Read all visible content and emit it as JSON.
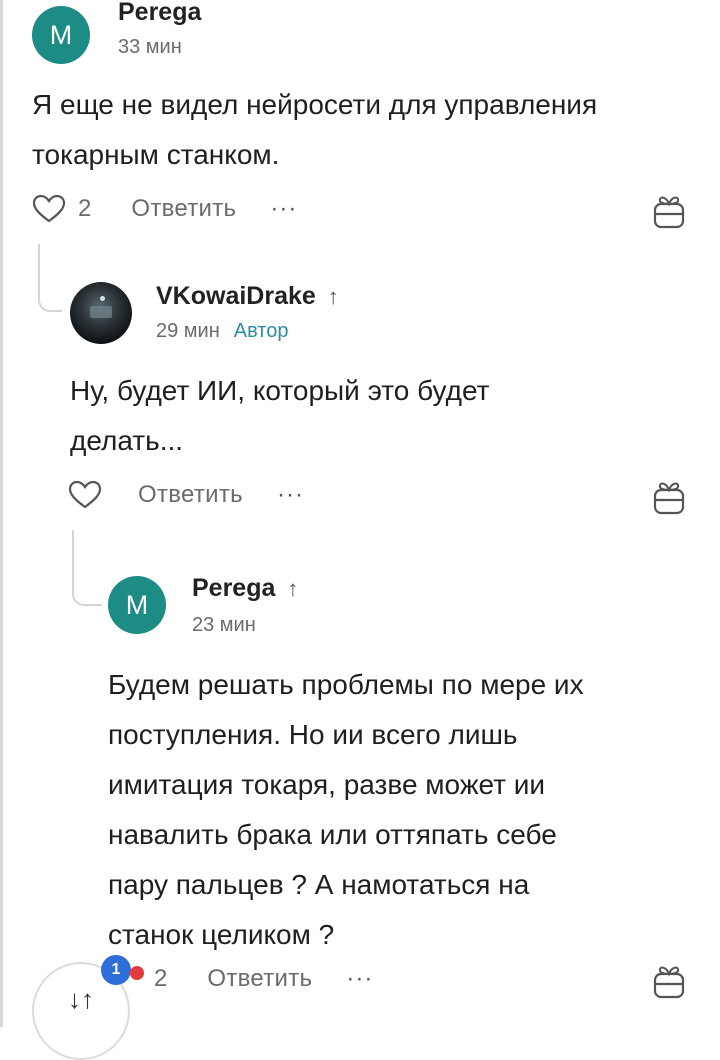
{
  "comments": [
    {
      "author": "Perega",
      "avatar_letter": "M",
      "time": "33 мин",
      "text_lines": [
        "Я еще не видел нейросети для управления",
        "токарным станком."
      ],
      "likes": "2",
      "reply_label": "Ответить",
      "more_label": "···"
    },
    {
      "author": "VKowaiDrake",
      "arrow": "↑",
      "time": "29 мин",
      "author_badge": "Автор",
      "text_lines": [
        "Ну, будет ИИ, который это будет",
        "делать..."
      ],
      "reply_label": "Ответить",
      "more_label": "···"
    },
    {
      "author": "Perega",
      "arrow": "↑",
      "avatar_letter": "M",
      "time": "23 мин",
      "text_lines": [
        "Будем решать проблемы по мере их",
        "поступления. Но ии всего лишь",
        "имитация токаря, разве может ии",
        "навалить брака или оттяпать себе",
        "пару пальцев ? А намотаться на",
        "станок целиком ?"
      ],
      "likes": "2",
      "reply_label": "Ответить",
      "more_label": "···"
    }
  ],
  "floating": {
    "vote_icon": "↓↑",
    "badge_count": "1"
  },
  "icons": [
    "heart-icon",
    "gift-icon",
    "sort-arrows-icon"
  ],
  "colors": {
    "avatar": "#1c8c84",
    "author_badge": "#2a8ea3",
    "notification": "#2e6ed8"
  }
}
